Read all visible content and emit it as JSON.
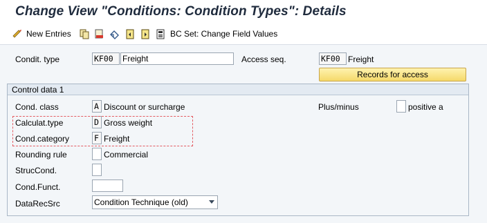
{
  "window": {
    "title": "Change View \"Conditions: Condition Types\": Details"
  },
  "toolbar": {
    "new_entries_label": "New Entries",
    "bc_set_label": "BC Set: Change Field Values",
    "icons": [
      "glasses-icon",
      "copy-icon",
      "delete-icon",
      "undo-icon",
      "previous-entry-icon",
      "next-entry-icon",
      "bc-set-icon"
    ]
  },
  "header": {
    "condit_type_label": "Condit. type",
    "condit_type_key": "KF00",
    "condit_type_value": "Freight",
    "access_seq_label": "Access seq.",
    "access_seq_key": "KF00",
    "access_seq_value": "Freight",
    "records_button_label": "Records for access"
  },
  "control_data": {
    "group_title": "Control data 1",
    "cond_class_label": "Cond. class",
    "cond_class_key": "A",
    "cond_class_value": "Discount or surcharge",
    "plus_minus_label": "Plus/minus",
    "plus_minus_key": "",
    "plus_minus_value": "positive a",
    "calc_type_label": "Calculat.type",
    "calc_type_key": "D",
    "calc_type_value": "Gross weight",
    "cond_category_label": "Cond.category",
    "cond_category_key": "F",
    "cond_category_value": "Freight",
    "rounding_rule_label": "Rounding rule",
    "rounding_rule_key": "",
    "rounding_rule_value": "Commercial",
    "struc_cond_label": "StrucCond.",
    "struc_cond_key": "",
    "cond_funct_label": "Cond.Funct.",
    "cond_funct_value": "",
    "data_rec_src_label": "DataRecSrc",
    "data_rec_src_value": "Condition Technique (old)"
  },
  "colors": {
    "title": "#1f2b3d",
    "button_yellow": "#f5d96a",
    "highlight_red": "#e35a60",
    "background": "#f3f6f9"
  }
}
